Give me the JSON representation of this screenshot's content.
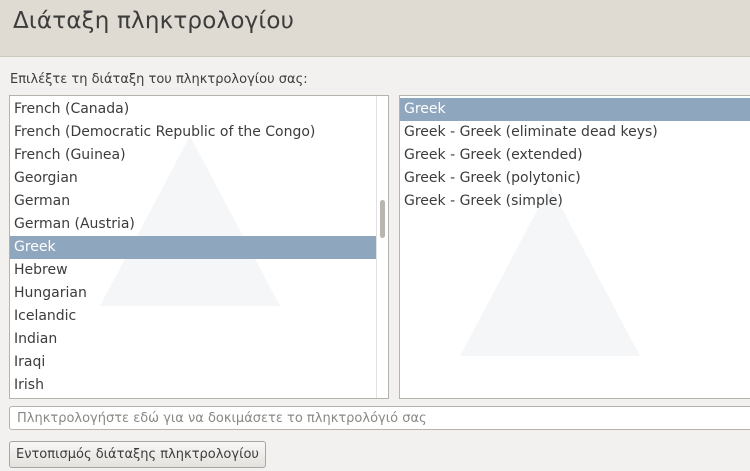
{
  "header": {
    "title": "Διάταξη πληκτρολογίου"
  },
  "prompt": "Επιλέξτε τη διάταξη του πληκτρολογίου σας:",
  "layouts": {
    "items": [
      "French (Canada)",
      "French (Democratic Republic of the Congo)",
      "French (Guinea)",
      "Georgian",
      "German",
      "German (Austria)",
      "Greek",
      "Hebrew",
      "Hungarian",
      "Icelandic",
      "Indian",
      "Iraqi",
      "Irish"
    ],
    "selected": "Greek"
  },
  "variants": {
    "items": [
      "Greek",
      "Greek - Greek (eliminate dead keys)",
      "Greek - Greek (extended)",
      "Greek - Greek (polytonic)",
      "Greek - Greek (simple)"
    ],
    "selected": "Greek"
  },
  "test_input": {
    "placeholder": "Πληκτρολογήστε εδώ για να δοκιμάσετε το πληκτρολόγιό σας",
    "value": ""
  },
  "detect_button": {
    "label": "Εντοπισμός διάταξης πληκτρολογίου"
  },
  "colors": {
    "selection": "#8fa6bf",
    "header_bg": "#dfdbd2",
    "window_bg": "#f2f1f0"
  }
}
